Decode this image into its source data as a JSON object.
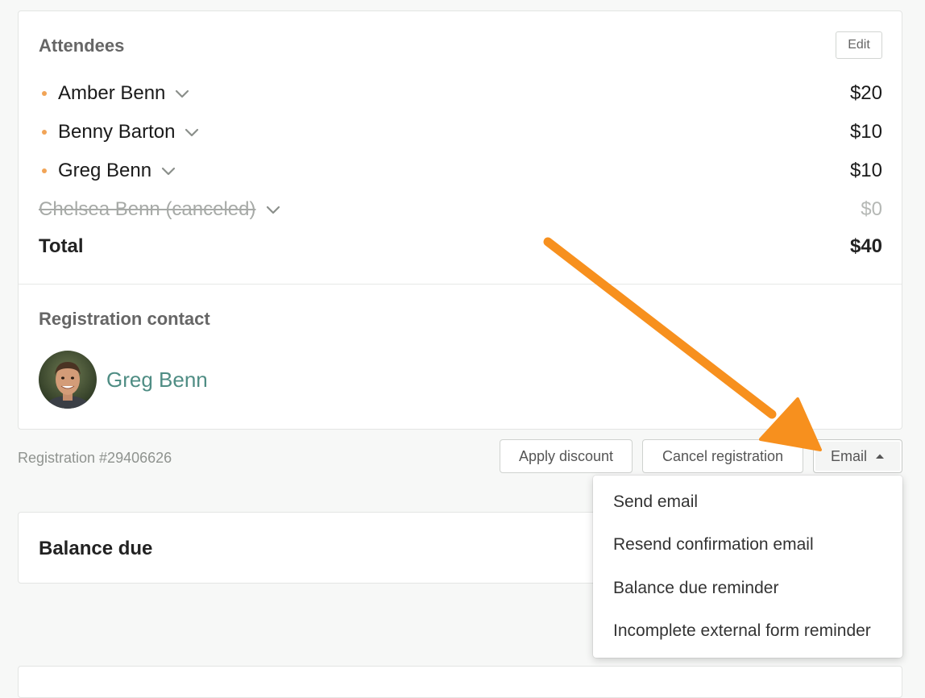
{
  "attendees": {
    "title": "Attendees",
    "edit_label": "Edit",
    "items": [
      {
        "name": "Amber Benn",
        "price": "$20",
        "canceled": false
      },
      {
        "name": "Benny Barton",
        "price": "$10",
        "canceled": false
      },
      {
        "name": "Greg Benn",
        "price": "$10",
        "canceled": false
      },
      {
        "name": "Chelsea Benn (canceled)",
        "price": "$0",
        "canceled": true
      }
    ],
    "total_label": "Total",
    "total_value": "$40"
  },
  "contact": {
    "title": "Registration contact",
    "name": "Greg Benn"
  },
  "footer": {
    "registration_id": "Registration #29406626",
    "apply_discount_label": "Apply discount",
    "cancel_registration_label": "Cancel registration",
    "email_label": "Email"
  },
  "email_menu": {
    "items": [
      "Send email",
      "Resend confirmation email",
      "Balance due reminder",
      "Incomplete external form reminder"
    ]
  },
  "balance": {
    "title": "Balance due"
  },
  "colors": {
    "accent_link": "#4f8d84",
    "bullet": "#f1a457",
    "annotation_arrow": "#f7901e"
  },
  "icons": {
    "attendee_expand": "chevron-down-icon",
    "email_menu_toggle": "caret-up-icon",
    "annotation": "arrow-annotation-icon"
  }
}
